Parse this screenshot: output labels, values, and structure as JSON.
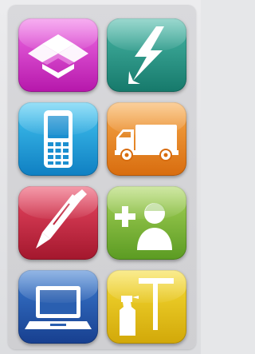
{
  "tiles": [
    {
      "name": "dropbox",
      "color_top": "#f06ee6",
      "color_bottom": "#b617ab"
    },
    {
      "name": "power",
      "color_top": "#49b8a7",
      "color_bottom": "#16796b"
    },
    {
      "name": "mobile-phone",
      "color_top": "#44c6f2",
      "color_bottom": "#0f7fc2"
    },
    {
      "name": "delivery-truck",
      "color_top": "#f7a94a",
      "color_bottom": "#d86c0e"
    },
    {
      "name": "pen",
      "color_top": "#ea4964",
      "color_bottom": "#a3172d"
    },
    {
      "name": "add-user",
      "color_top": "#a8d45a",
      "color_bottom": "#5b9b22"
    },
    {
      "name": "laptop",
      "color_top": "#3b7bd0",
      "color_bottom": "#173f8f"
    },
    {
      "name": "cleaning",
      "color_top": "#f6dc35",
      "color_bottom": "#d2a809"
    }
  ]
}
